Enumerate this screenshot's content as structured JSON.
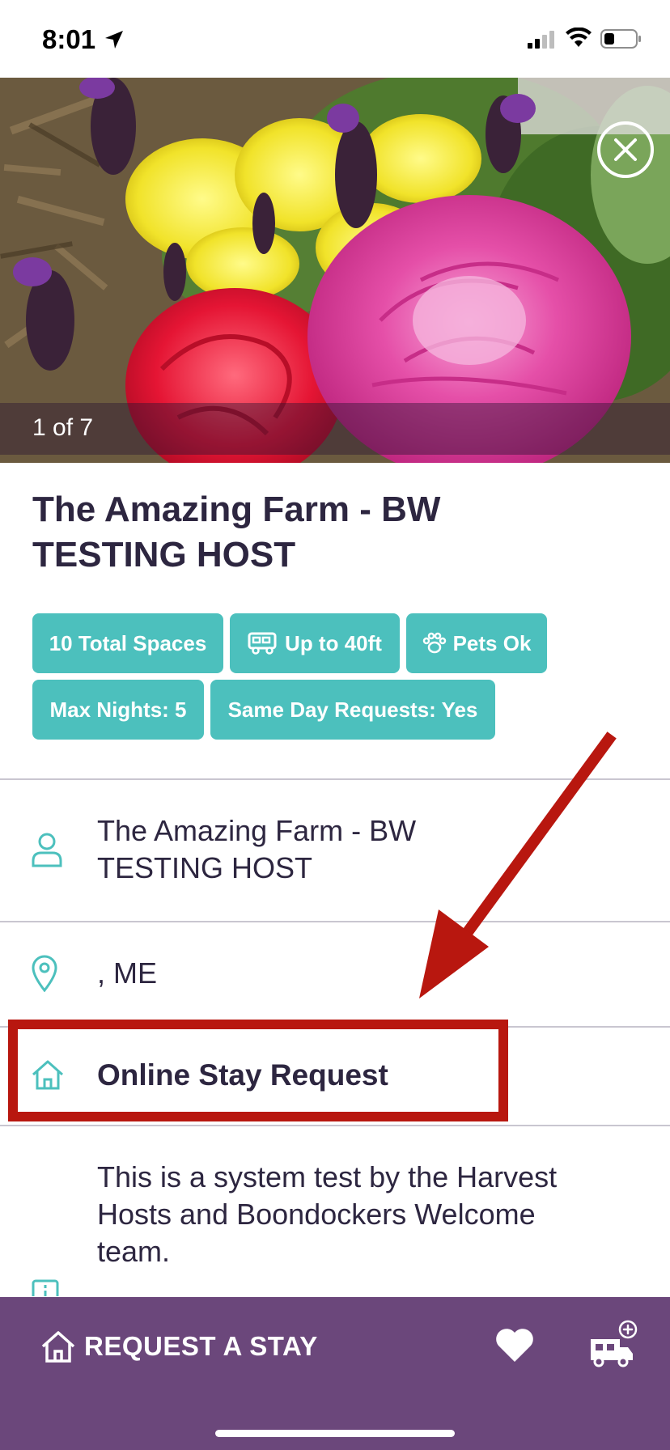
{
  "status_bar": {
    "time": "8:01"
  },
  "hero": {
    "counter": "1 of 7"
  },
  "listing": {
    "title": "The Amazing Farm - BW TESTING HOST",
    "chips": [
      {
        "label": "10 Total Spaces",
        "icon": ""
      },
      {
        "label": "Up to 40ft",
        "icon": "rv-icon"
      },
      {
        "label": "Pets Ok",
        "icon": "paw-icon"
      },
      {
        "label": "Max Nights: 5",
        "icon": ""
      },
      {
        "label": "Same Day Requests: Yes",
        "icon": ""
      }
    ]
  },
  "info_rows": {
    "host_name": "The Amazing Farm - BW TESTING HOST",
    "location": ", ME",
    "booking_type": "Online Stay Request",
    "description": "This is a system test by the Harvest Hosts and Boondockers Welcome team."
  },
  "bottom_bar": {
    "request_label": "REQUEST A STAY"
  },
  "colors": {
    "accent": "#4cc0bd",
    "bottom_bar": "#6b477b",
    "annotation": "#b8170f",
    "text": "#2d2640"
  }
}
